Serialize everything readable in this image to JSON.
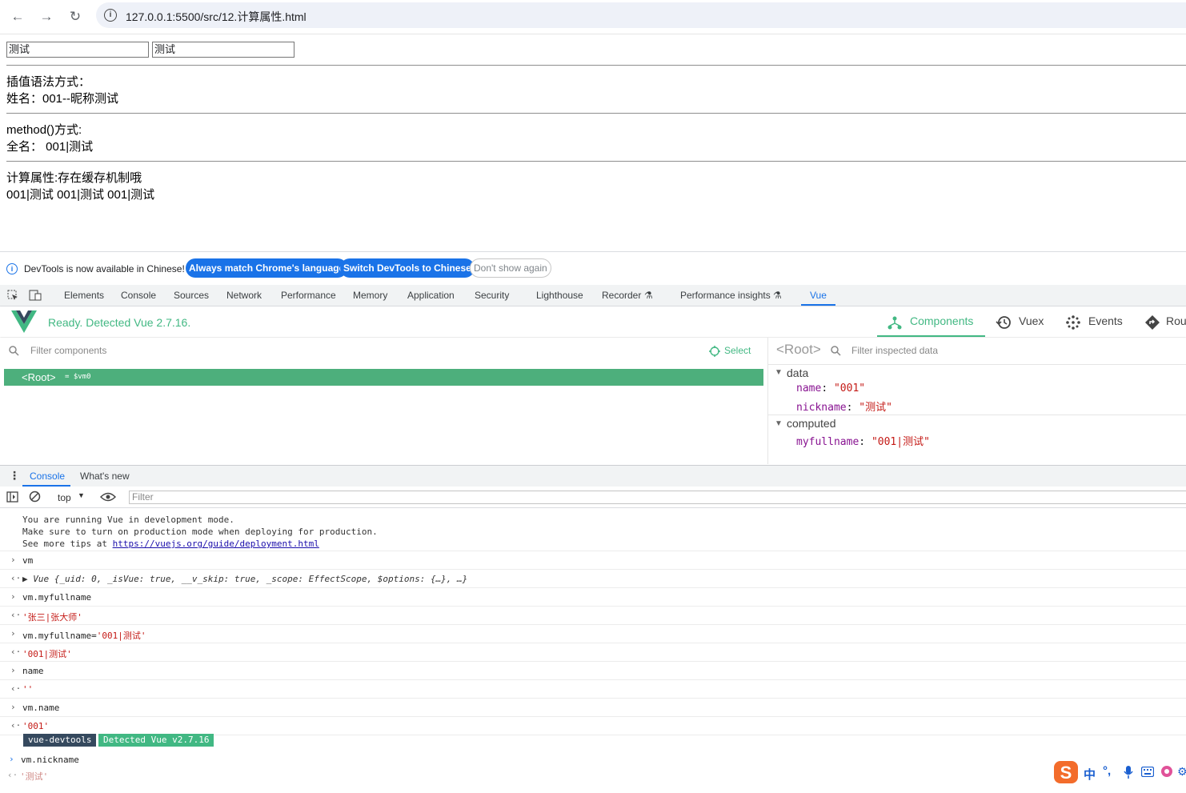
{
  "browser": {
    "url": "127.0.0.1:5500/src/12.计算属性.html"
  },
  "page": {
    "input1_value": "测试",
    "input2_value": "测试",
    "section1_title": "插值语法方式：",
    "section1_value": "姓名：001--昵称测试",
    "section2_title": "method()方式:",
    "section2_value": "全名： 001|测试",
    "section3_title": "计算属性:存在缓存机制哦",
    "section3_value": "001|测试 001|测试 001|测试"
  },
  "notice": {
    "message": "DevTools is now available in Chinese!",
    "btn_match": "Always match Chrome's language",
    "btn_switch": "Switch DevTools to Chinese",
    "btn_dismiss": "Don't show again"
  },
  "devtools_tabs": [
    "Elements",
    "Console",
    "Sources",
    "Network",
    "Performance",
    "Memory",
    "Application",
    "Security",
    "Lighthouse",
    "Recorder",
    "Performance insights",
    "Vue"
  ],
  "vue": {
    "status": "Ready. Detected Vue 2.7.16.",
    "nav": [
      "Components",
      "Vuex",
      "Events",
      "Rou"
    ],
    "filter_components": "Filter components",
    "select_label": "Select",
    "root_label": "<Root>",
    "root_var": "= $vm0",
    "inspector_root": "<Root>",
    "filter_inspected": "Filter inspected data",
    "data_section": "data",
    "data_name_key": "name",
    "data_name_val": "\"001\"",
    "data_nick_key": "nickname",
    "data_nick_val": "\"测试\"",
    "computed_section": "computed",
    "computed_key": "myfullname",
    "computed_val": "\"001|测试\""
  },
  "drawer": {
    "tab_console": "Console",
    "tab_whatsnew": "What's new",
    "context": "top",
    "filter_placeholder": "Filter"
  },
  "console": {
    "msg_line1": "You are running Vue in development mode.",
    "msg_line2": "Make sure to turn on production mode when deploying for production.",
    "msg_line3_prefix": "See more tips at ",
    "msg_link": "https://vuejs.org/guide/deployment.html",
    "in1": "vm",
    "out1": "Vue {_uid: 0, _isVue: true, __v_skip: true, _scope: EffectScope, $options: {…}, …}",
    "in2": "vm.myfullname",
    "out2": "'张三|张大师'",
    "in3_prefix": "vm.myfullname=",
    "in3_str": "'001|测试'",
    "out3": "'001|测试'",
    "in4": "name",
    "out4": "''",
    "in5": "vm.name",
    "out5": "'001'",
    "badge_devtools": "vue-devtools",
    "badge_detected": "Detected Vue v2.7.16",
    "in6": "vm.nickname",
    "out6": "'测试'"
  },
  "ime": {
    "lang": "中"
  }
}
